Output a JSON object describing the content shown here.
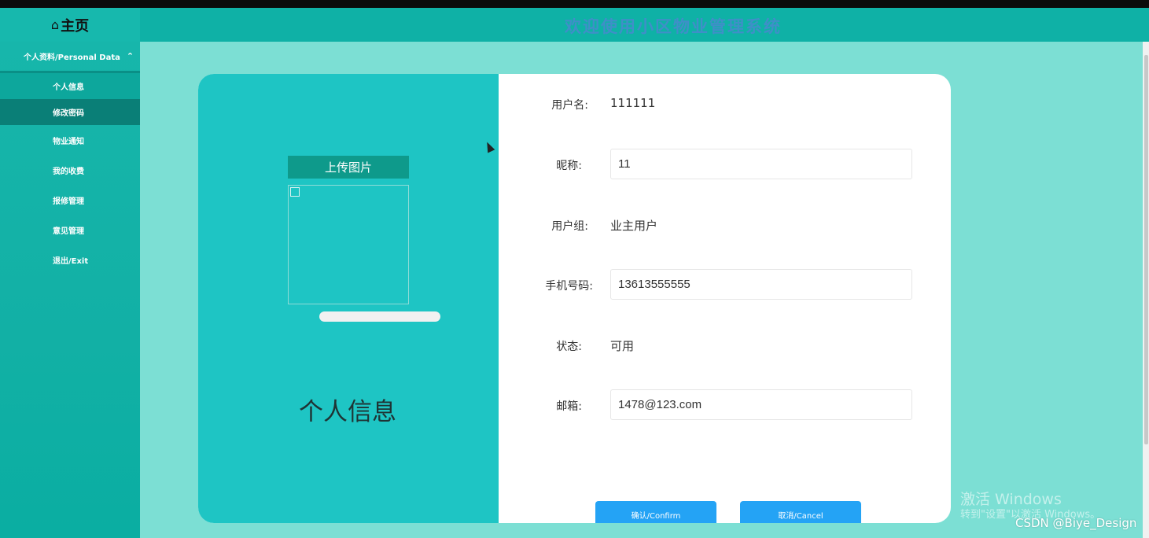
{
  "header": {
    "home_icon": "home-icon",
    "home_label": "主页",
    "site_title": "欢迎使用小区物业管理系统"
  },
  "sidebar": {
    "group_label": "个人资料/Personal Data",
    "group_icon": "chevron-up-icon",
    "items": [
      {
        "label": "个人信息"
      },
      {
        "label": "修改密码"
      },
      {
        "label": "物业通知"
      },
      {
        "label": "我的收费"
      },
      {
        "label": "报修管理"
      },
      {
        "label": "意见管理"
      },
      {
        "label": "退出/Exit"
      }
    ]
  },
  "left_panel": {
    "upload_button": "上传图片",
    "title": "个人信息"
  },
  "form": {
    "username_label": "用户名:",
    "username_value": "111111",
    "nickname_label": "昵称:",
    "nickname_value": "11",
    "group_label": "用户组:",
    "group_value": "业主用户",
    "phone_label": "手机号码:",
    "phone_value": "13613555555",
    "status_label": "状态:",
    "status_value": "可用",
    "email_label": "邮箱:",
    "email_value": "1478@123.com"
  },
  "buttons": {
    "confirm": "确认/Confirm",
    "cancel": "取消/Cancel"
  },
  "watermark": {
    "line1": "激活 Windows",
    "line2": "转到\"设置\"以激活 Windows。",
    "credit": "CSDN @Biye_Design"
  },
  "colors": {
    "teal_header": "#0fb1a6",
    "page_bg": "#7cdfd4",
    "panel_teal": "#1ec5c4",
    "button_blue": "#24a3f5"
  }
}
